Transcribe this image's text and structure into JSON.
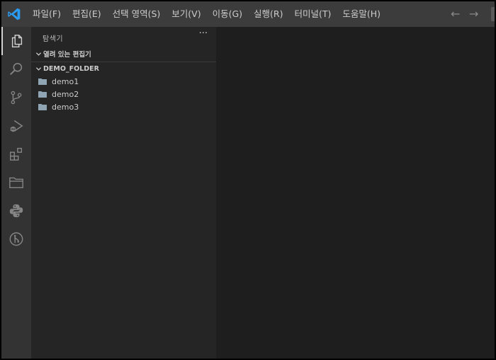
{
  "menu": [
    "파일(F)",
    "편집(E)",
    "선택 영역(S)",
    "보기(V)",
    "이동(G)",
    "실행(R)",
    "터미널(T)",
    "도움말(H)"
  ],
  "nav": {
    "back": "←",
    "forward": "→"
  },
  "activity": [
    "explorer-icon",
    "search-icon",
    "source-control-icon",
    "run-debug-icon",
    "extensions-icon",
    "folder-icon",
    "python-icon",
    "git-graph-icon"
  ],
  "sidebar": {
    "title": "탐색기",
    "more": "···",
    "open_editors": "열려 있는 편집기",
    "folder": "DEMO_FOLDER",
    "items": [
      "demo1",
      "demo2",
      "demo3"
    ]
  },
  "colors": {
    "accent": "#0078d4",
    "titlebar": "#3c3c3c",
    "activitybar": "#333333",
    "sidebar": "#252526",
    "editor": "#1e1e1e"
  }
}
